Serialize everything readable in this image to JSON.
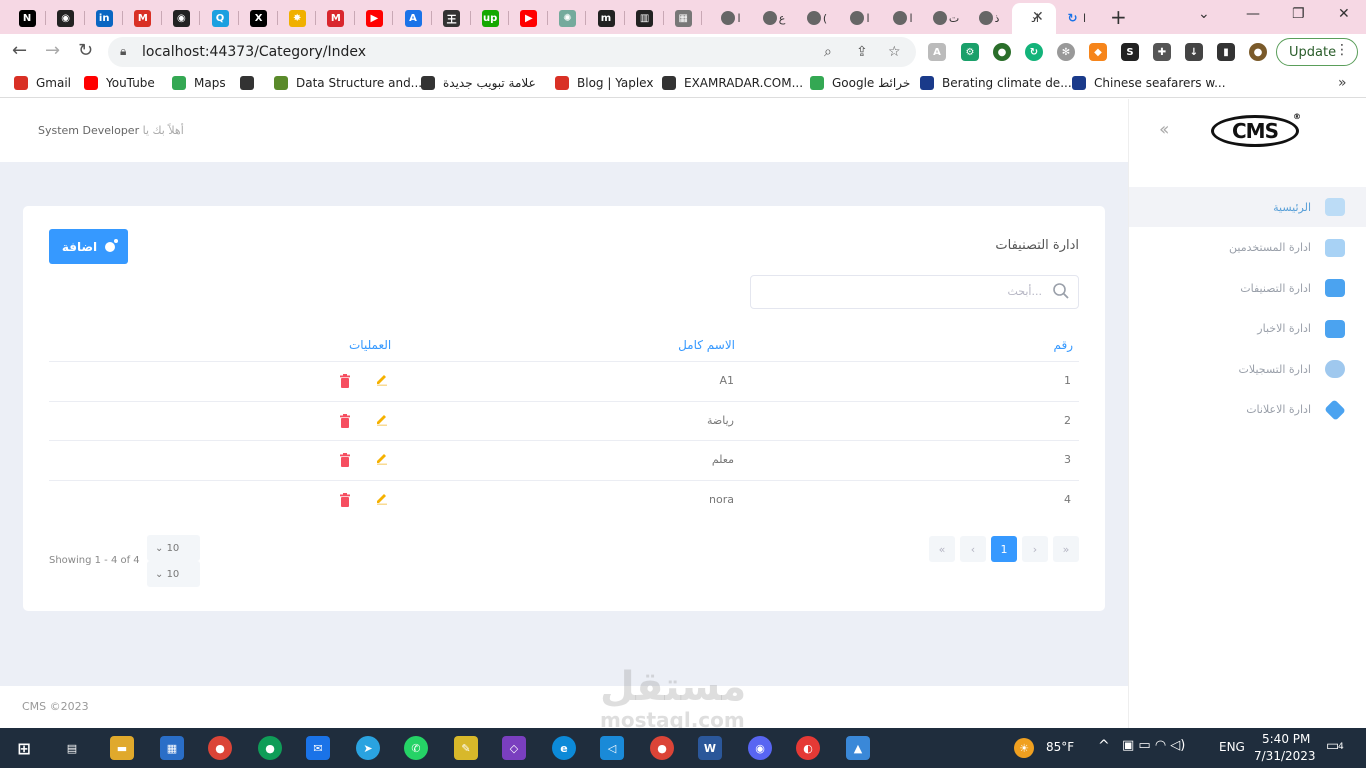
{
  "browser": {
    "tabs": [
      {
        "icon": "notion-icon",
        "glyph": "N",
        "color": "#000000"
      },
      {
        "icon": "github-icon",
        "glyph": "◉",
        "color": "#222222"
      },
      {
        "icon": "linkedin-icon",
        "glyph": "in",
        "color": "#0a66c2"
      },
      {
        "icon": "gmail-icon",
        "glyph": "M",
        "color": "#d93025"
      },
      {
        "icon": "github-icon",
        "glyph": "◉",
        "color": "#222222"
      },
      {
        "icon": "q-icon",
        "glyph": "Q",
        "color": "#1aa0e0"
      },
      {
        "icon": "x-icon",
        "glyph": "X",
        "color": "#000000"
      },
      {
        "icon": "sun-icon",
        "glyph": "✸",
        "color": "#f0b000"
      },
      {
        "icon": "mega-icon",
        "glyph": "M",
        "color": "#d9272e"
      },
      {
        "icon": "youtube-icon",
        "glyph": "▶",
        "color": "#ff0000"
      },
      {
        "icon": "appstore-icon",
        "glyph": "A",
        "color": "#1a73e8"
      },
      {
        "icon": "chinese-char-icon",
        "glyph": "王",
        "color": "#333333"
      },
      {
        "icon": "upwork-icon",
        "glyph": "up",
        "color": "#14a800"
      },
      {
        "icon": "youtube-icon",
        "glyph": "▶",
        "color": "#ff0000"
      },
      {
        "icon": "chatgpt-icon",
        "glyph": "✺",
        "color": "#74aa9c"
      },
      {
        "icon": "medium-icon",
        "glyph": "m",
        "color": "#222222"
      },
      {
        "icon": "trello-icon",
        "glyph": "▥",
        "color": "#222222"
      },
      {
        "icon": "calendar-icon",
        "glyph": "▦",
        "color": "#777777"
      }
    ],
    "short_tabs": [
      {
        "icon": "globe-icon",
        "title": "ا"
      },
      {
        "icon": "circle-icon",
        "title": "ع"
      },
      {
        "icon": "upwork-icon",
        "title": "("
      },
      {
        "icon": "globe-icon",
        "title": "ا"
      },
      {
        "icon": "five-icon",
        "title": "ا"
      },
      {
        "icon": "circle-icon",
        "title": "ت"
      },
      {
        "icon": "loading-icon",
        "title": "ذ"
      }
    ],
    "active_tab_title": "اد",
    "last_tab_title": "ا",
    "url": "localhost:44373/Category/Index",
    "update_label": "Update",
    "bookmarks": [
      {
        "label": "Gmail",
        "icon": "gmail-icon",
        "color": "#d93025"
      },
      {
        "label": "YouTube",
        "icon": "youtube-icon",
        "color": "#ff0000"
      },
      {
        "label": "Maps",
        "icon": "maps-icon",
        "color": "#34a853"
      },
      {
        "label": "",
        "icon": "globe-icon",
        "color": "#333333"
      },
      {
        "label": "Data Structure and...",
        "icon": "ds-icon",
        "color": "#5a8a2a"
      },
      {
        "label": "علامة تبويب جديدة",
        "icon": "globe-icon",
        "color": "#333333"
      },
      {
        "label": "Blog | Yaplex",
        "icon": "yaplex-icon",
        "color": "#d93025"
      },
      {
        "label": "EXAMRADAR.COM...",
        "icon": "globe-icon",
        "color": "#333333"
      },
      {
        "label": "Google خرائط",
        "icon": "maps-icon",
        "color": "#34a853"
      },
      {
        "label": "Berating climate de...",
        "icon": "news-icon",
        "color": "#1a3a8a"
      },
      {
        "label": "Chinese seafarers w...",
        "icon": "news-icon",
        "color": "#1a3a8a"
      }
    ]
  },
  "app": {
    "welcome_prefix": "أهلاً بك يا",
    "user_name": "System Developer",
    "logo": "CMS",
    "sidebar": [
      {
        "label": "الرئيسية",
        "icon": "home-icon",
        "active": true
      },
      {
        "label": "ادارة المستخدمين",
        "icon": "users-folder-icon",
        "active": false
      },
      {
        "label": "ادارة التصنيفات",
        "icon": "categories-icon",
        "active": false
      },
      {
        "label": "ادارة الاخبار",
        "icon": "edit-news-icon",
        "active": false
      },
      {
        "label": "ادارة التسجيلات",
        "icon": "cloud-music-icon",
        "active": false
      },
      {
        "label": "ادارة الاعلانات",
        "icon": "layers-icon",
        "active": false
      }
    ],
    "page_title": "ادارة التصنيفات",
    "add_label": "اضافة",
    "search_placeholder": "أبحث...",
    "table": {
      "headers": [
        "رقم",
        "الاسم كامل",
        "العمليات"
      ],
      "rows": [
        {
          "id": "1",
          "name": "A1"
        },
        {
          "id": "2",
          "name": "رياضة"
        },
        {
          "id": "3",
          "name": "معلم"
        },
        {
          "id": "4",
          "name": "nora"
        }
      ]
    },
    "pagination": {
      "first": "«",
      "prev": "‹",
      "current": "1",
      "next": "›",
      "last": "»"
    },
    "showing": "Showing 1 - 4 of 4",
    "page_size": "10",
    "footer": "CMS ©2023"
  },
  "watermark": "مستقل",
  "watermark_sub": "mostaql.com",
  "taskbar": {
    "weather": "85°F",
    "lang": "ENG",
    "time": "5:40 PM",
    "date": "7/31/2023",
    "notifications": "4"
  },
  "colors": {
    "accent": "#3699ff",
    "edit": "#f6b100",
    "delete": "#f64e60"
  }
}
